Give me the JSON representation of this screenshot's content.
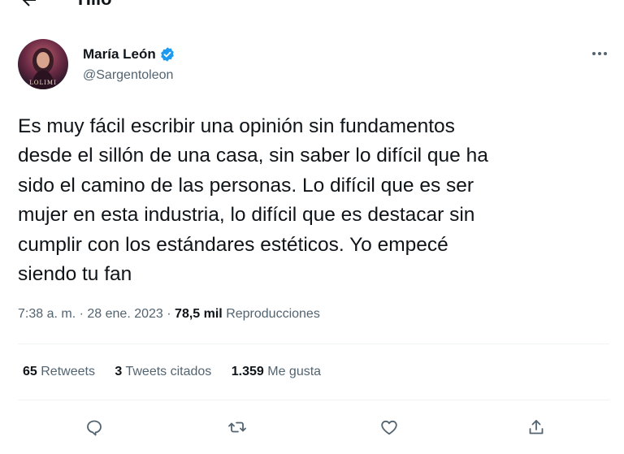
{
  "header": {
    "title": "Hilo"
  },
  "tweet": {
    "author_name": "María León",
    "handle": "@Sargentoleon",
    "avatar_caption": "LOLIMI",
    "text": "Es muy fácil escribir una opinión sin fundamentos\ndesde el sillón de una casa, sin saber lo difícil que ha\nsido el camino de las personas. Lo difícil que es ser\nmujer en esta industria, lo difícil que es destacar sin\ncumplir con los estándares estéticos. Yo empecé\nsiendo tu fan",
    "time": "7:38 a. m.",
    "separator": "·",
    "date": "28 ene. 2023",
    "views_count": "78,5 mil",
    "views_label": "Reproducciones"
  },
  "stats": {
    "retweets_count": "65",
    "retweets_label": "Retweets",
    "quotes_count": "3",
    "quotes_label": "Tweets citados",
    "likes_count": "1.359",
    "likes_label": "Me gusta"
  },
  "colors": {
    "verified": "#1d9bf0",
    "secondary_text": "#536471",
    "divider": "#eff3f4"
  },
  "icons": [
    "back-arrow-icon",
    "verified-badge-icon",
    "more-options-icon",
    "reply-icon",
    "retweet-icon",
    "like-icon",
    "share-icon"
  ]
}
